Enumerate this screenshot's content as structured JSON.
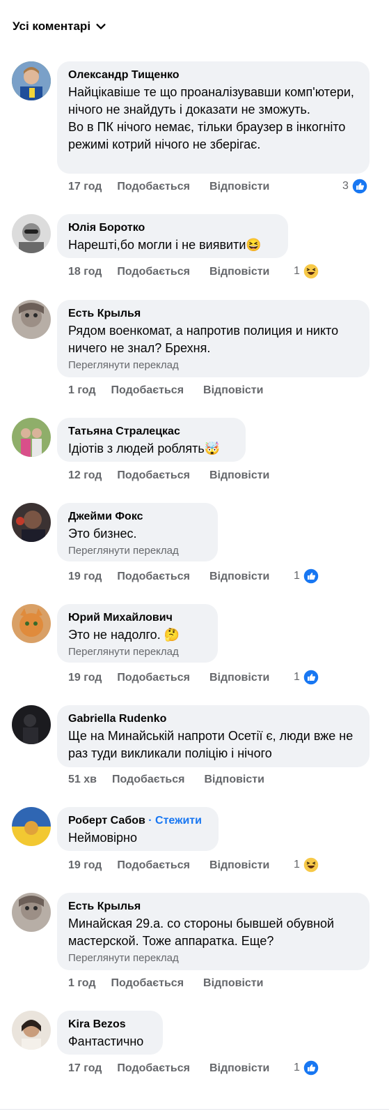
{
  "header": {
    "title": "Усі коментарі"
  },
  "comments": [
    {
      "author": "Олександр Тищенко",
      "text": "Найцікавіше те що проаналізувавши комп'ютери, нічого не знайдуть і доказати не зможуть.\nВо в ПК нічого немає, тільки браузер в інкогніто режимі котрий нічого не зберігає.",
      "translate": "",
      "time": "17 год",
      "like": "Подобається",
      "reply": "Відповісти",
      "reaction_count": "3",
      "reaction": "like-icon",
      "avatar_color": "#6b8e4e"
    },
    {
      "author": "Юлія Боротко",
      "text": "Нарешті,бо могли і не виявити😆",
      "translate": "",
      "time": "18 год",
      "like": "Подобається",
      "reply": "Відповісти",
      "reaction_count": "1",
      "reaction": "haha-icon",
      "avatar_color": "#9a9a9a"
    },
    {
      "author": "Есть Крылья",
      "text": "Рядом военкомат, а напротив полиция и никто ничего не знал? Брехня.",
      "translate": "Переглянути переклад",
      "time": "1 год",
      "like": "Подобається",
      "reply": "Відповісти",
      "reaction_count": "",
      "reaction": "",
      "avatar_color": "#8a7f78"
    },
    {
      "author": "Татьяна Стралецкас",
      "text": "Ідіотів з людей роблять🤯",
      "translate": "",
      "time": "12 год",
      "like": "Подобається",
      "reply": "Відповісти",
      "reaction_count": "",
      "reaction": "",
      "avatar_color": "#7f9a5a"
    },
    {
      "author": "Джейми Фокс",
      "text": "Это бизнес.",
      "translate": "Переглянути переклад",
      "time": "19 год",
      "like": "Подобається",
      "reply": "Відповісти",
      "reaction_count": "1",
      "reaction": "like-icon",
      "avatar_color": "#5a4a48"
    },
    {
      "author": "Юрий Михайлович",
      "text": "Это не надолго. 🤔",
      "translate": "Переглянути переклад",
      "time": "19 год",
      "like": "Подобається",
      "reply": "Відповісти",
      "reaction_count": "1",
      "reaction": "like-icon",
      "avatar_color": "#c9823e"
    },
    {
      "author": "Gabriella Rudenko",
      "text": "Ще на Минайській напроти Осетії є, люди вже не раз туди викликали поліцію і нічого",
      "translate": "",
      "time": "51 хв",
      "like": "Подобається",
      "reply": "Відповісти",
      "reaction_count": "",
      "reaction": "",
      "avatar_color": "#1e1e22"
    },
    {
      "author": "Роберт Сабов",
      "follow": "· Стежити",
      "text": "Неймовірно",
      "translate": "",
      "time": "19 год",
      "like": "Подобається",
      "reply": "Відповісти",
      "reaction_count": "1",
      "reaction": "haha-icon",
      "avatar_color": "#3a6fb0"
    },
    {
      "author": "Есть Крылья",
      "text": "Минайская 29.а.  со стороны бывшей обувной мастерской. Тоже аппаратка. Еще?",
      "translate": "Переглянути переклад",
      "time": "1 год",
      "like": "Подобається",
      "reply": "Відповісти",
      "reaction_count": "",
      "reaction": "",
      "avatar_color": "#8a7f78"
    },
    {
      "author": "Kira Bezos",
      "text": "Фантастично",
      "translate": "",
      "time": "17 год",
      "like": "Подобається",
      "reply": "Відповісти",
      "reaction_count": "1",
      "reaction": "like-icon",
      "avatar_color": "#d8c7b5"
    }
  ]
}
